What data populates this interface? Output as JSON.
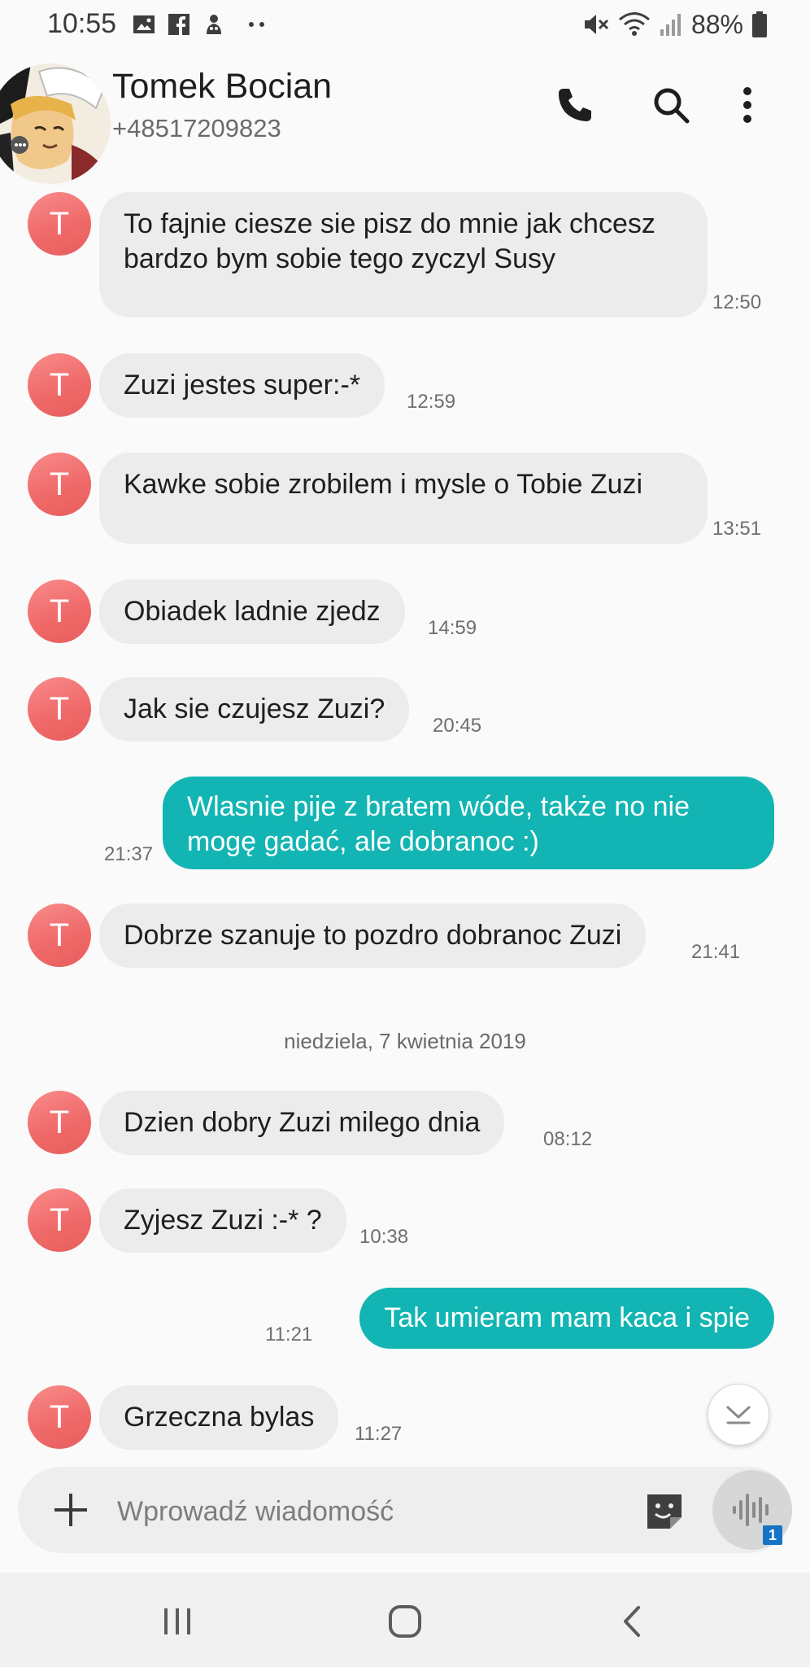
{
  "status_bar": {
    "time": "10:55",
    "battery": "88%",
    "notif_icons": [
      "image-icon",
      "facebook-icon",
      "app-icon",
      "more-dots-icon"
    ],
    "right_icons": [
      "mute-icon",
      "wifi-icon",
      "signal-icon",
      "battery-icon"
    ]
  },
  "header": {
    "name": "Tomek Bocian",
    "number": "+48517209823",
    "actions": [
      "phone-icon",
      "search-icon",
      "more-vert-icon"
    ]
  },
  "avatar_letter": "T",
  "messages": [
    {
      "dir": "in",
      "text": "To fajnie ciesze sie pisz do mnie jak chcesz bardzo bym sobie tego zyczyl Susy",
      "time": "12:50"
    },
    {
      "dir": "in",
      "text": "Zuzi jestes super:-*",
      "time": "12:59"
    },
    {
      "dir": "in",
      "text": "Kawke sobie zrobilem i mysle o Tobie Zuzi",
      "time": "13:51"
    },
    {
      "dir": "in",
      "text": "Obiadek ladnie zjedz",
      "time": "14:59"
    },
    {
      "dir": "in",
      "text": "Jak sie czujesz Zuzi?",
      "time": "20:45"
    },
    {
      "dir": "out",
      "text": "Wlasnie pije z bratem wóde, także no nie mogę gadać, ale dobranoc :)",
      "time": "21:37"
    },
    {
      "dir": "in",
      "text": "Dobrze szanuje to pozdro dobranoc Zuzi",
      "time": "21:41"
    },
    {
      "dir": "in",
      "text": "Dzien dobry Zuzi milego dnia",
      "time": "08:12"
    },
    {
      "dir": "in",
      "text": "Zyjesz Zuzi :-* ?",
      "time": "10:38"
    },
    {
      "dir": "out",
      "text": "Tak umieram mam kaca i spie",
      "time": "11:21"
    },
    {
      "dir": "in",
      "text": "Grzeczna bylas",
      "time": "11:27"
    }
  ],
  "date_separator": "niedziela, 7 kwietnia 2019",
  "composer": {
    "placeholder": "Wprowadź wiadomość",
    "sim_badge": "1"
  },
  "colors": {
    "incoming_bubble": "#ececed",
    "outgoing_bubble": "#12b5b3",
    "avatar": "#f06a6a"
  }
}
